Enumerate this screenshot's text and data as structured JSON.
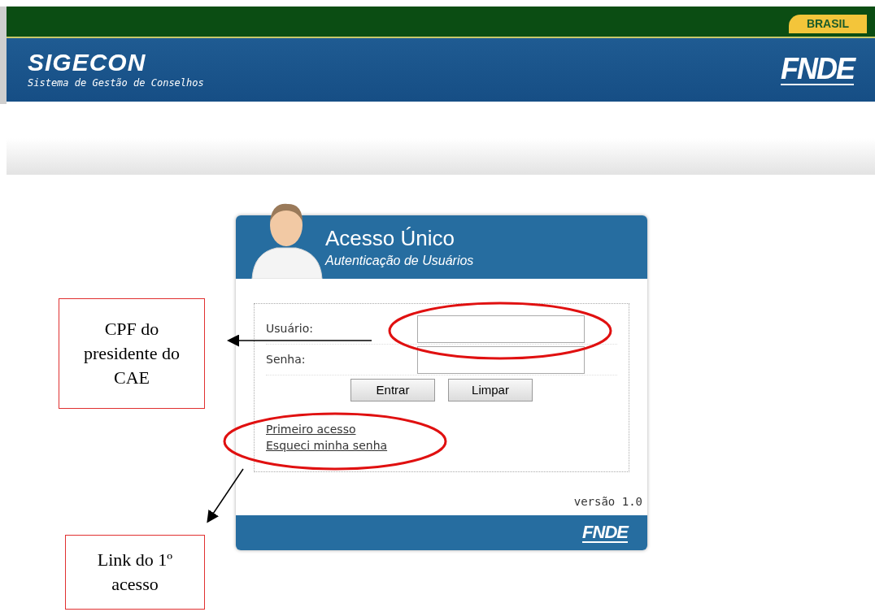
{
  "header": {
    "badge": "BRASIL",
    "app_name": "SIGECON",
    "app_subtitle": "Sistema de Gestão de Conselhos",
    "logo": "FNDE"
  },
  "login_card": {
    "title": "Acesso Único",
    "subtitle": "Autenticação de Usuários",
    "fields": [
      {
        "label": "Usuário:"
      },
      {
        "label": "Senha:"
      }
    ],
    "buttons": [
      "Entrar",
      "Limpar"
    ],
    "links": [
      "Primeiro acesso",
      "Esqueci minha senha"
    ],
    "version": "versão 1.0",
    "footer_logo": "FNDE"
  },
  "annotations": [
    {
      "text": "CPF do presidente do CAE"
    },
    {
      "text": "Link do 1º acesso"
    }
  ]
}
